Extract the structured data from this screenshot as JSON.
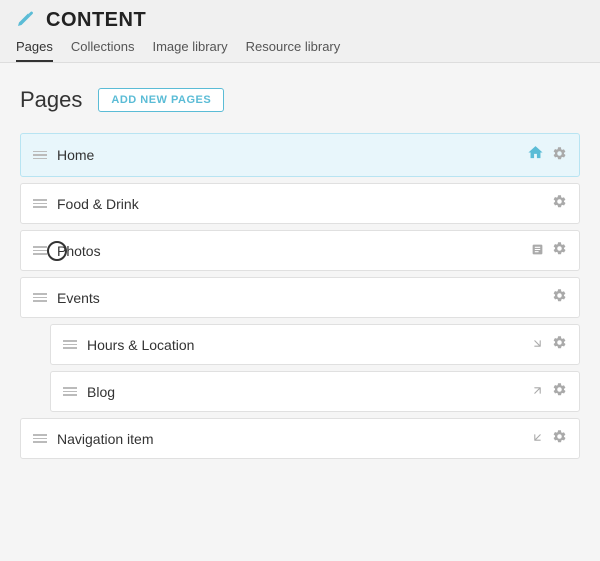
{
  "topbar": {
    "title": "CONTENT",
    "pencil_icon": "✏",
    "nav_items": [
      {
        "label": "Pages",
        "active": true
      },
      {
        "label": "Collections",
        "active": false
      },
      {
        "label": "Image library",
        "active": false
      },
      {
        "label": "Resource library",
        "active": false
      }
    ]
  },
  "main": {
    "page_heading": "Pages",
    "add_button_label": "ADD NEW PAGES",
    "pages": [
      {
        "id": "home",
        "label": "Home",
        "indented": false,
        "active": true,
        "has_home_icon": true,
        "has_link_icon": false,
        "has_gear": true
      },
      {
        "id": "food-drink",
        "label": "Food & Drink",
        "indented": false,
        "active": false,
        "has_home_icon": false,
        "has_link_icon": false,
        "has_gear": true
      },
      {
        "id": "photos",
        "label": "Photos",
        "indented": false,
        "active": false,
        "has_home_icon": false,
        "has_link_icon": true,
        "has_gear": true
      },
      {
        "id": "events",
        "label": "Events",
        "indented": false,
        "active": false,
        "has_home_icon": false,
        "has_link_icon": false,
        "has_gear": true
      },
      {
        "id": "hours-location",
        "label": "Hours & Location",
        "indented": true,
        "active": false,
        "has_home_icon": false,
        "has_link_icon": true,
        "has_gear": true
      },
      {
        "id": "blog",
        "label": "Blog",
        "indented": true,
        "active": false,
        "has_home_icon": false,
        "has_link_icon": true,
        "has_gear": true
      },
      {
        "id": "navigation-item",
        "label": "Navigation item",
        "indented": false,
        "active": false,
        "has_home_icon": false,
        "has_link_icon": true,
        "has_gear": true
      }
    ]
  }
}
